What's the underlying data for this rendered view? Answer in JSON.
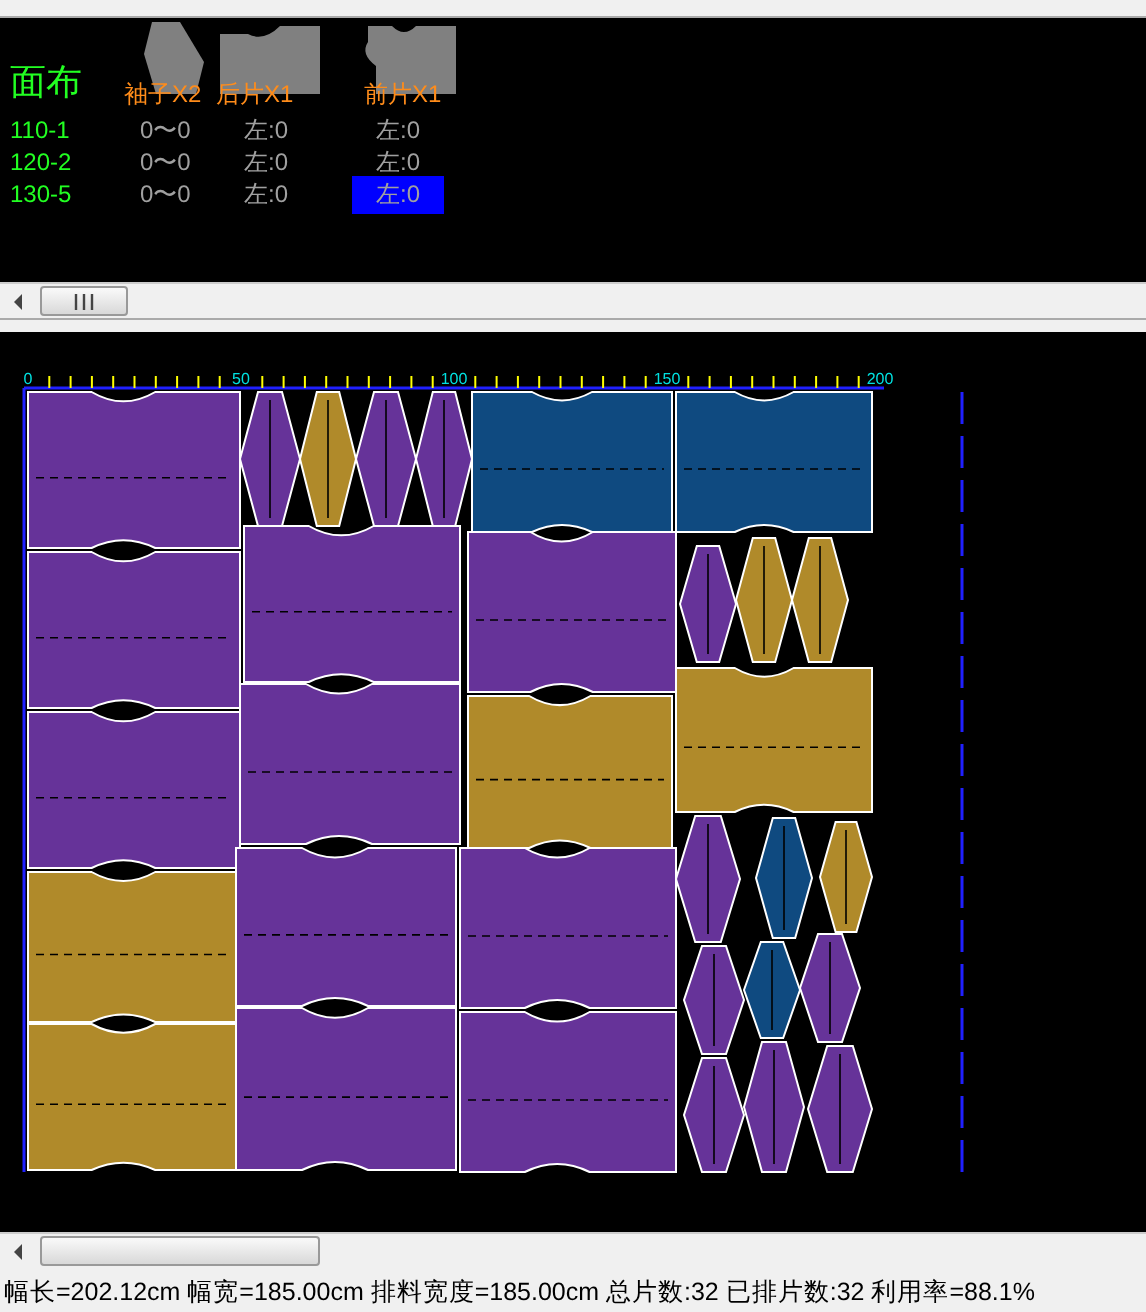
{
  "fabric_label": "面布",
  "piece_headers": [
    {
      "label": "袖子X2",
      "kind": "sleeve"
    },
    {
      "label": "后片X1",
      "kind": "back"
    },
    {
      "label": "前片X1",
      "kind": "front"
    }
  ],
  "sizes": [
    {
      "size": "110-1",
      "cells": [
        {
          "text": "0〜0",
          "selected": false
        },
        {
          "text": "左:0",
          "selected": false
        },
        {
          "text": "左:0",
          "selected": false
        }
      ]
    },
    {
      "size": "120-2",
      "cells": [
        {
          "text": "0〜0",
          "selected": false
        },
        {
          "text": "左:0",
          "selected": false
        },
        {
          "text": "左:0",
          "selected": false
        }
      ]
    },
    {
      "size": "130-5",
      "cells": [
        {
          "text": "0〜0",
          "selected": false
        },
        {
          "text": "左:0",
          "selected": false
        },
        {
          "text": "左:0",
          "selected": true
        }
      ]
    }
  ],
  "ruler": {
    "labels": [
      "0",
      "50",
      "100",
      "150",
      "200"
    ]
  },
  "marker_pieces": [
    {
      "color": "#663399"
    },
    {
      "color": "#663399"
    },
    {
      "color": "#663399"
    },
    {
      "color": "#b08a2a"
    },
    {
      "color": "#b08a2a"
    },
    {
      "color": "#663399"
    },
    {
      "color": "#b08a2a"
    },
    {
      "color": "#663399"
    },
    {
      "color": "#663399"
    },
    {
      "color": "#663399"
    },
    {
      "color": "#663399"
    },
    {
      "color": "#663399"
    },
    {
      "color": "#663399"
    },
    {
      "color": "#0f4a80"
    },
    {
      "color": "#663399"
    },
    {
      "color": "#b08a2a"
    },
    {
      "color": "#663399"
    },
    {
      "color": "#663399"
    },
    {
      "color": "#0f4a80"
    },
    {
      "color": "#663399"
    },
    {
      "color": "#b08a2a"
    },
    {
      "color": "#b08a2a"
    },
    {
      "color": "#b08a2a"
    },
    {
      "color": "#663399"
    },
    {
      "color": "#0f4a80"
    },
    {
      "color": "#b08a2a"
    },
    {
      "color": "#663399"
    },
    {
      "color": "#0f4a80"
    },
    {
      "color": "#663399"
    },
    {
      "color": "#663399"
    },
    {
      "color": "#663399"
    },
    {
      "color": "#663399"
    }
  ],
  "status_bar": "幅长=202.12cm 幅宽=185.00cm 排料宽度=185.00cm 总片数:32 已排片数:32 利用率=88.1%"
}
